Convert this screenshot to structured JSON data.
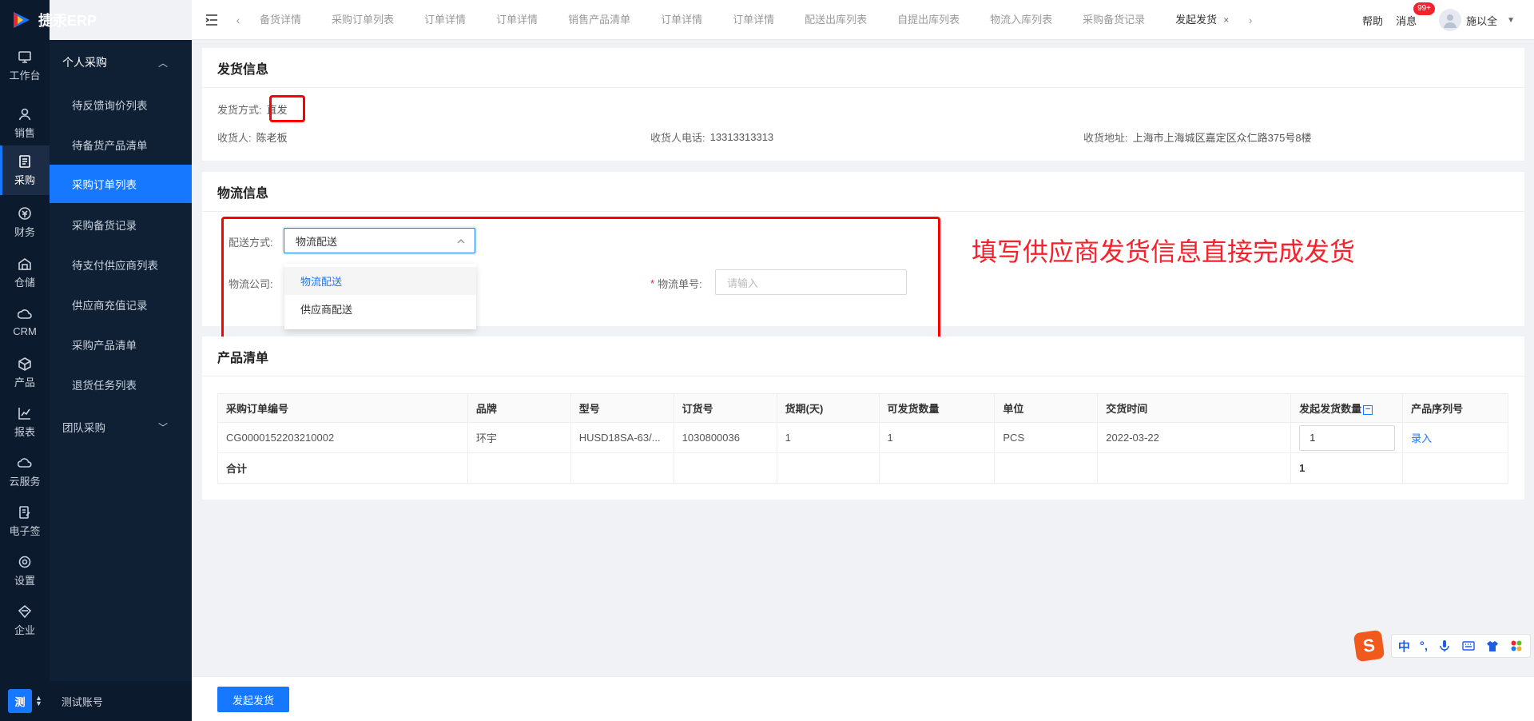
{
  "app": {
    "logo_text": "捷汞ERP"
  },
  "rail": [
    {
      "label": "工作台",
      "icon": "workbench-icon"
    },
    {
      "label": "销售",
      "icon": "sales-icon"
    },
    {
      "label": "采购",
      "icon": "purchase-icon"
    },
    {
      "label": "财务",
      "icon": "finance-icon"
    },
    {
      "label": "仓储",
      "icon": "warehouse-icon"
    },
    {
      "label": "CRM",
      "icon": "crm-icon"
    },
    {
      "label": "产品",
      "icon": "product-icon"
    },
    {
      "label": "报表",
      "icon": "report-icon"
    },
    {
      "label": "云服务",
      "icon": "cloud-icon"
    },
    {
      "label": "电子签",
      "icon": "esign-icon"
    },
    {
      "label": "设置",
      "icon": "settings-icon"
    },
    {
      "label": "企业",
      "icon": "enterprise-icon"
    }
  ],
  "subnav": {
    "group1": "个人采购",
    "items": [
      "待反馈询价列表",
      "待备货产品清单",
      "采购订单列表",
      "采购备货记录",
      "待支付供应商列表",
      "供应商充值记录",
      "采购产品清单",
      "退货任务列表"
    ],
    "group2": "团队采购"
  },
  "account": {
    "badge": "测",
    "name": "测试账号"
  },
  "tabs": [
    "备货详情",
    "采购订单列表",
    "订单详情",
    "订单详情",
    "销售产品清单",
    "订单详情",
    "订单详情",
    "配送出库列表",
    "自提出库列表",
    "物流入库列表",
    "采购备货记录",
    "发起发货"
  ],
  "tab_close": "×",
  "topbar": {
    "help": "帮助",
    "messages": "消息",
    "msg_badge": "99+",
    "user": "施以全"
  },
  "ship_info": {
    "title": "发货信息",
    "method_label": "发货方式:",
    "method_value": "直发",
    "receiver_label": "收货人:",
    "receiver_value": "陈老板",
    "phone_label": "收货人电话:",
    "phone_value": "13313313313",
    "address_label": "收货地址:",
    "address_value": "上海市上海城区嘉定区众仁路375号8楼"
  },
  "logistics": {
    "title": "物流信息",
    "delivery_label": "配送方式:",
    "delivery_value": "物流配送",
    "options": [
      "物流配送",
      "供应商配送"
    ],
    "company_label": "物流公司:",
    "tracking_label": "物流单号:",
    "tracking_placeholder": "请输入"
  },
  "annotation": "填写供应商发货信息直接完成发货",
  "products": {
    "title": "产品清单",
    "columns": [
      "采购订单编号",
      "品牌",
      "型号",
      "订货号",
      "货期(天)",
      "可发货数量",
      "单位",
      "交货时间",
      "发起发货数量",
      "产品序列号"
    ],
    "rows": [
      [
        "CG0000152203210002",
        "环宇",
        "HUSD18SA-63/...",
        "1030800036",
        "1",
        "1",
        "PCS",
        "2022-03-22",
        "1",
        "录入"
      ]
    ],
    "total_label": "合计",
    "total_qty": "1"
  },
  "footer": {
    "submit": "发起发货"
  },
  "ime": {
    "logo": "S",
    "lang": "中",
    "punct": "°,"
  }
}
